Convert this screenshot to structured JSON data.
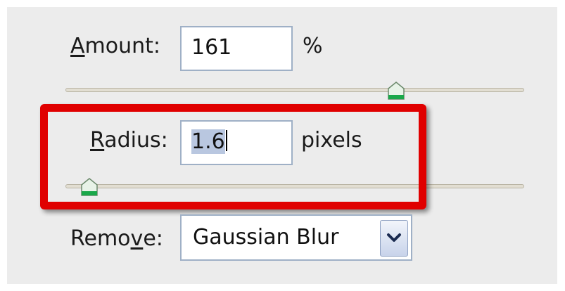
{
  "amount": {
    "label_underlined": "A",
    "label_rest": "mount:",
    "value": "161",
    "unit": "%",
    "slider_fraction": 0.7
  },
  "radius": {
    "label_underlined": "R",
    "label_rest": "adius:",
    "value": "1.6",
    "unit": "pixels",
    "slider_fraction": 0.03
  },
  "remove": {
    "label_before": "Remo",
    "label_underlined": "v",
    "label_after": "e:",
    "selected": "Gaussian Blur"
  },
  "colors": {
    "highlight_border": "#e00000",
    "panel_background": "#ececec",
    "thumb_fill": "#1aa84a"
  },
  "icons": {
    "slider_thumb": "slider-thumb-icon",
    "dropdown": "chevron-down-icon"
  }
}
